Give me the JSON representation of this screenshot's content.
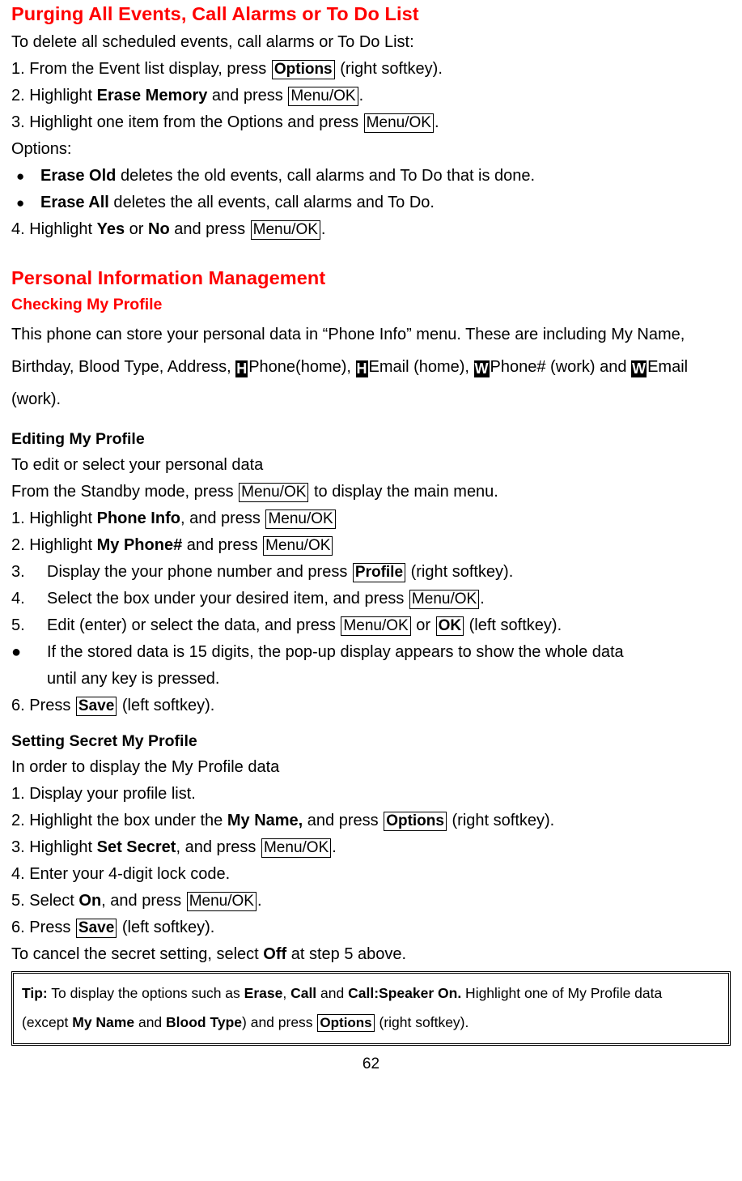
{
  "page": {
    "number": "62",
    "accent_color": "#ff0000",
    "text_color": "#000000",
    "background": "#ffffff"
  },
  "section_purging": {
    "heading": "Purging All Events, Call Alarms or To Do List",
    "intro": "To delete all scheduled events, call alarms or To Do List:",
    "step1_a": "1. From the Event list display, press ",
    "step1_key": "Options",
    "step1_b": " (right softkey).",
    "step2_a": "2. Highlight ",
    "step2_bold": "Erase Memory",
    "step2_b": " and press ",
    "step2_key": "Menu/OK",
    "step2_c": ".",
    "step3_a": "3. Highlight one item from the Options and press ",
    "step3_key": "Menu/OK",
    "step3_b": ".",
    "options_label": "Options:",
    "bullet1_bold": "Erase Old",
    "bullet1_rest": " deletes the old events, call alarms and To Do that is done.",
    "bullet2_bold": "Erase All",
    "bullet2_rest": " deletes the all events, call alarms and To Do.",
    "step4_a": "4. Highlight ",
    "step4_bold1": "Yes",
    "step4_mid": " or ",
    "step4_bold2": "No",
    "step4_b": " and press ",
    "step4_key": "Menu/OK",
    "step4_c": ".",
    "bullet_glyph": "●"
  },
  "section_pim": {
    "heading": "Personal Information Management",
    "sub_checking": "Checking My Profile",
    "checking_p1": "This phone can store your personal data in “Phone Info” menu. These are including My Name, Birthday, Blood Type, Address, ",
    "icon_h1": "H",
    "checking_p2": "Phone(home), ",
    "icon_h2": "H",
    "checking_p3": "Email (home), ",
    "icon_w1": "W",
    "checking_p4": "Phone# (work) and ",
    "icon_w2": "W",
    "checking_p5": "Email (work)."
  },
  "section_editing": {
    "sub_editing": "Editing My Profile",
    "intro": "To edit or select your personal data",
    "standby_a": "From the Standby mode, press ",
    "standby_key": "Menu/OK",
    "standby_b": " to display the main menu.",
    "step1_a": "1. Highlight ",
    "step1_bold": "Phone Info",
    "step1_b": ", and press ",
    "step1_key": "Menu/OK",
    "step2_a": "2. Highlight ",
    "step2_bold": "My Phone#",
    "step2_b": " and press ",
    "step2_key": "Menu/OK",
    "step3_num": "3.",
    "step3_a": "Display the your phone number and press ",
    "step3_key": "Profile",
    "step3_b": " (right softkey).",
    "step4_num": "4.",
    "step4_a": "Select the box under your desired item, and press ",
    "step4_key": "Menu/OK",
    "step4_b": ".",
    "step5_num": "5.",
    "step5_a": "Edit (enter) or select the data, and press ",
    "step5_key1": "Menu/OK",
    "step5_mid": " or ",
    "step5_key2": "OK",
    "step5_b": " (left softkey).",
    "bullet_glyph": "●",
    "bullet_line1": "If the stored data is 15 digits, the pop-up display appears to show the whole data",
    "bullet_line2": "until any key is pressed.",
    "step6_a": "6. Press ",
    "step6_key": "Save",
    "step6_b": " (left softkey)."
  },
  "section_secret": {
    "sub_secret": "Setting Secret My Profile",
    "intro": "In order to display the My Profile data",
    "step1": "1. Display your profile list.",
    "step2_a": "2. Highlight the box under the ",
    "step2_bold": "My Name,",
    "step2_b": " and press ",
    "step2_key": "Options",
    "step2_c": " (right softkey).",
    "step3_a": "3. Highlight ",
    "step3_bold": "Set Secret",
    "step3_b": ", and press ",
    "step3_key": "Menu/OK",
    "step3_c": ".",
    "step4": "4. Enter your 4-digit lock code.",
    "step5_a": "5. Select ",
    "step5_bold": "On",
    "step5_b": ", and press ",
    "step5_key": "Menu/OK",
    "step5_c": ".",
    "step6_a": "6. Press ",
    "step6_key": "Save",
    "step6_b": " (left softkey).",
    "cancel_a": "To cancel the secret setting, select ",
    "cancel_bold": "Off",
    "cancel_b": " at step 5 above."
  },
  "tip": {
    "label": "Tip:",
    "line1_a": " To display the options such as ",
    "line1_b1": "Erase",
    "line1_mid1": ", ",
    "line1_b2": "Call",
    "line1_mid2": " and ",
    "line1_b3": "Call:Speaker On.",
    "line1_c": " Highlight one of My Profile data",
    "line2_a": "(except ",
    "line2_b1": "My Name",
    "line2_mid": " and ",
    "line2_b2": "Blood Type",
    "line2_c": ") and press ",
    "line2_key": "Options",
    "line2_d": " (right softkey)."
  }
}
